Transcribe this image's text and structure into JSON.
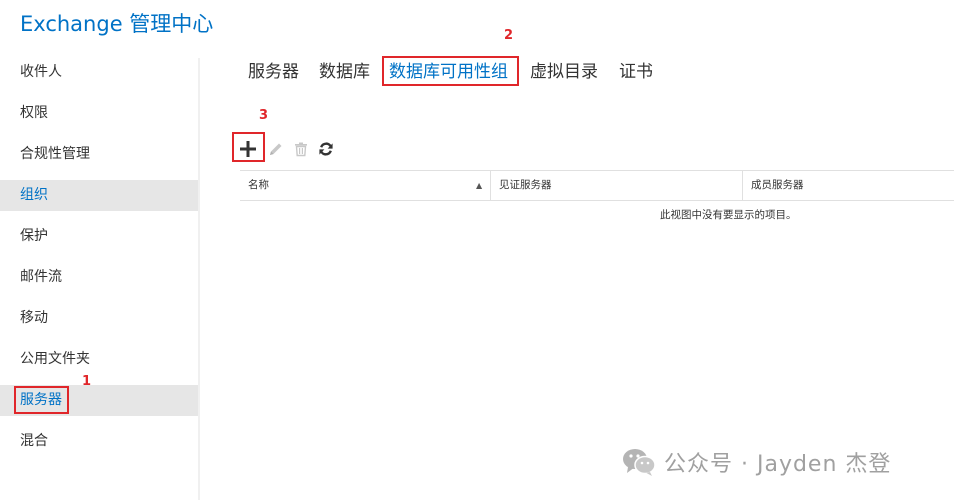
{
  "app": {
    "title": "Exchange 管理中心"
  },
  "sidebar": {
    "items": [
      {
        "label": "收件人"
      },
      {
        "label": "权限"
      },
      {
        "label": "合规性管理"
      },
      {
        "label": "组织"
      },
      {
        "label": "保护"
      },
      {
        "label": "邮件流"
      },
      {
        "label": "移动"
      },
      {
        "label": "公用文件夹"
      },
      {
        "label": "服务器"
      },
      {
        "label": "混合"
      }
    ]
  },
  "tabs": [
    {
      "label": "服务器"
    },
    {
      "label": "数据库"
    },
    {
      "label": "数据库可用性组"
    },
    {
      "label": "虚拟目录"
    },
    {
      "label": "证书"
    }
  ],
  "toolbar": {
    "add": "add-icon",
    "edit": "pencil-icon",
    "delete": "trash-icon",
    "refresh": "refresh-icon"
  },
  "grid": {
    "columns": [
      {
        "label": "名称"
      },
      {
        "label": "见证服务器"
      },
      {
        "label": "成员服务器"
      }
    ],
    "empty_message": "此视图中没有要显示的项目。"
  },
  "annotations": {
    "n1": "1",
    "n2": "2",
    "n3": "3"
  },
  "watermark": {
    "text": "公众号 · Jayden 杰登"
  },
  "colors": {
    "accent": "#0072c6",
    "callout": "#e0262a"
  }
}
